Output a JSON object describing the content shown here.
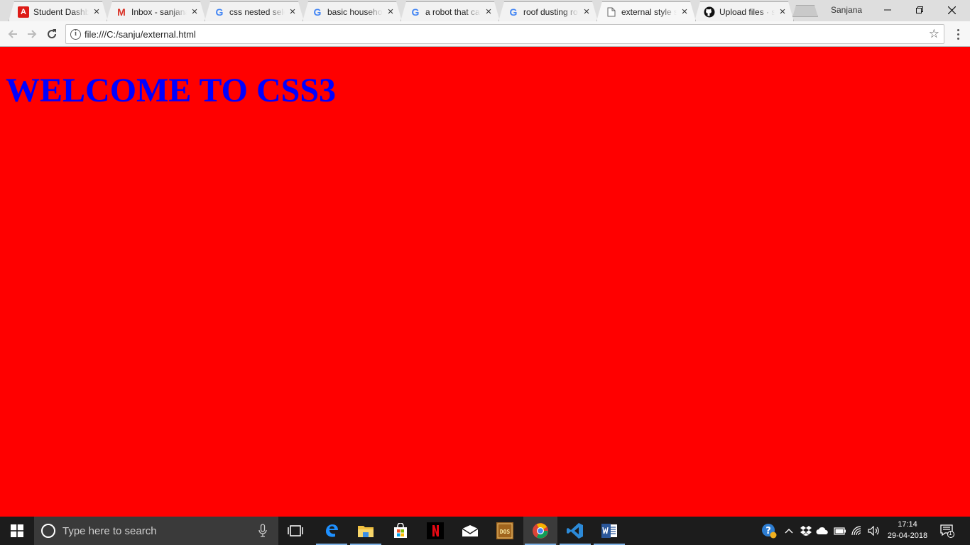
{
  "browser": {
    "tabs": [
      {
        "title": "Student Dashb",
        "icon": "angular-icon",
        "color": "#dd1b16"
      },
      {
        "title": "Inbox - sanjana",
        "icon": "gmail-icon",
        "color": "#d93025"
      },
      {
        "title": "css nested sele",
        "icon": "google-icon",
        "color": "#4285f4"
      },
      {
        "title": "basic househol",
        "icon": "google-icon",
        "color": "#4285f4"
      },
      {
        "title": "a robot that ca",
        "icon": "google-icon",
        "color": "#4285f4"
      },
      {
        "title": "roof dusting ro",
        "icon": "google-icon",
        "color": "#4285f4"
      },
      {
        "title": "external style s",
        "icon": "document-icon",
        "color": "#666666",
        "active": true
      },
      {
        "title": "Upload files · s",
        "icon": "github-icon",
        "color": "#111111"
      }
    ],
    "profile_name": "Sanjana",
    "address": "file:///C:/sanju/external.html"
  },
  "page": {
    "heading": "WELCOME TO CSS3",
    "background_color": "#ff0000",
    "heading_color": "#0000ff"
  },
  "taskbar": {
    "search_placeholder": "Type here to search",
    "apps": [
      {
        "name": "task-view",
        "icon": "task-view-icon"
      },
      {
        "name": "edge",
        "icon": "edge-icon"
      },
      {
        "name": "file-explorer",
        "icon": "folder-icon"
      },
      {
        "name": "store",
        "icon": "store-icon"
      },
      {
        "name": "netflix",
        "icon": "netflix-icon"
      },
      {
        "name": "mail",
        "icon": "mail-icon"
      },
      {
        "name": "dosbox",
        "icon": "dosbox-icon"
      },
      {
        "name": "chrome",
        "icon": "chrome-icon"
      },
      {
        "name": "vscode",
        "icon": "vscode-icon"
      },
      {
        "name": "word",
        "icon": "word-icon"
      }
    ],
    "time": "17:14",
    "date": "29-04-2018",
    "notification_count": "1"
  }
}
